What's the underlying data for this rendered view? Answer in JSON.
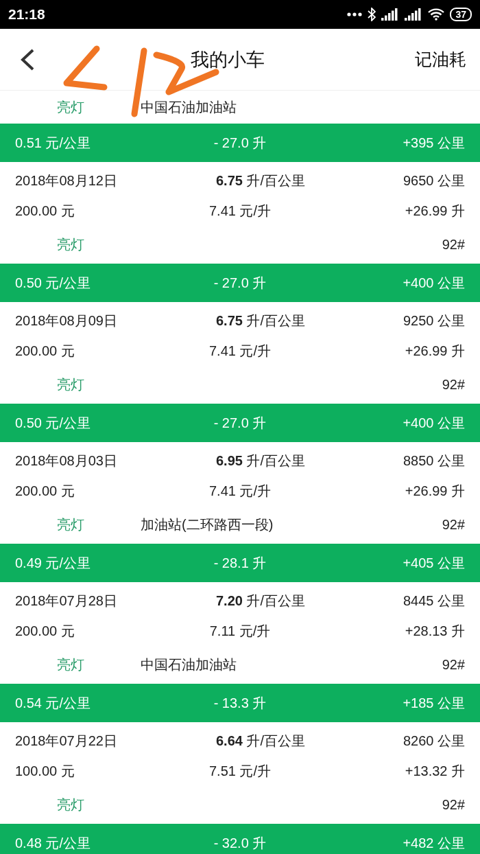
{
  "status_bar": {
    "time": "21:18",
    "battery": "37"
  },
  "header": {
    "title": "我的小车",
    "action": "记油耗"
  },
  "items": [
    {
      "kind": "record",
      "tag": "亮灯",
      "station": "中国石油加油站"
    },
    {
      "kind": "summary",
      "cost_per_km": "0.51 元/公里",
      "fuel_used": "- 27.0 升",
      "distance": "+395 公里"
    },
    {
      "kind": "record",
      "date": "2018年08月12日",
      "consumption": "**6.75** 升/百公里",
      "odometer": "9650 公里",
      "amount": "200.00 元",
      "price": "7.41 元/升",
      "added": "+26.99 升",
      "tag": "亮灯",
      "grade": "92#"
    },
    {
      "kind": "summary",
      "cost_per_km": "0.50 元/公里",
      "fuel_used": "- 27.0 升",
      "distance": "+400 公里"
    },
    {
      "kind": "record",
      "date": "2018年08月09日",
      "consumption": "**6.75** 升/百公里",
      "odometer": "9250 公里",
      "amount": "200.00 元",
      "price": "7.41 元/升",
      "added": "+26.99 升",
      "tag": "亮灯",
      "grade": "92#"
    },
    {
      "kind": "summary",
      "cost_per_km": "0.50 元/公里",
      "fuel_used": "- 27.0 升",
      "distance": "+400 公里"
    },
    {
      "kind": "record",
      "date": "2018年08月03日",
      "consumption": "**6.95** 升/百公里",
      "odometer": "8850 公里",
      "amount": "200.00 元",
      "price": "7.41 元/升",
      "added": "+26.99 升",
      "tag": "亮灯",
      "station": "加油站(二环路西一段)",
      "grade": "92#"
    },
    {
      "kind": "summary",
      "cost_per_km": "0.49 元/公里",
      "fuel_used": "- 28.1 升",
      "distance": "+405 公里"
    },
    {
      "kind": "record",
      "date": "2018年07月28日",
      "consumption": "**7.20** 升/百公里",
      "odometer": "8445 公里",
      "amount": "200.00 元",
      "price": "7.11 元/升",
      "added": "+28.13 升",
      "tag": "亮灯",
      "station": "中国石油加油站",
      "grade": "92#"
    },
    {
      "kind": "summary",
      "cost_per_km": "0.54 元/公里",
      "fuel_used": "- 13.3 升",
      "distance": "+185 公里"
    },
    {
      "kind": "record",
      "date": "2018年07月22日",
      "consumption": "**6.64** 升/百公里",
      "odometer": "8260 公里",
      "amount": "100.00 元",
      "price": "7.51 元/升",
      "added": "+13.32 升",
      "tag": "亮灯",
      "grade": "92#"
    },
    {
      "kind": "summary",
      "cost_per_km": "0.48 元/公里",
      "fuel_used": "- 32.0 升",
      "distance": "+482 公里"
    }
  ]
}
